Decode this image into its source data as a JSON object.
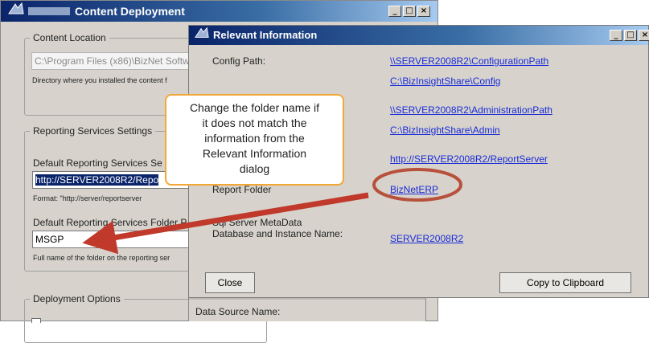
{
  "content_window": {
    "title": "Content Deployment",
    "location_group": {
      "legend": "Content Location",
      "path_value": "C:\\Program Files (x86)\\BizNet Softw",
      "hint": "Directory where you installed the content f"
    },
    "reporting_group": {
      "legend": "Reporting Services Settings",
      "server_label": "Default Reporting Services Se",
      "server_value": "http://SERVER2008R2/Repo",
      "server_hint": "Format: \"http://server/reportserver",
      "folder_label": "Default Reporting Services Folder P",
      "folder_value": "MSGP",
      "folder_hint": "Full name of the folder on the reporting ser"
    },
    "deployment_group": {
      "legend": "Deployment Options",
      "data_source_label": "Data Source Name:"
    }
  },
  "info_window": {
    "title": "Relevant Information",
    "rows": [
      {
        "label": "Config Path:",
        "link": "\\\\SERVER2008R2\\ConfigurationPath"
      },
      {
        "label": "",
        "link": "C:\\BizInsightShare\\Config"
      },
      {
        "label": "",
        "link": "\\\\SERVER2008R2\\AdministrationPath"
      },
      {
        "label": "",
        "link": "C:\\BizInsightShare\\Admin"
      },
      {
        "label": "",
        "link": "http://SERVER2008R2/ReportServer"
      },
      {
        "label": "Report Folder",
        "link": "BizNetERP"
      },
      {
        "label": "Sql Server MetaData\nDatabase and Instance Name:",
        "link": "SERVER2008R2"
      }
    ],
    "close_label": "Close",
    "copy_label": "Copy to Clipboard"
  },
  "callout": {
    "lines": [
      "Change the folder name if",
      "it does not match the",
      "information from the",
      "Relevant Information",
      "dialog"
    ]
  },
  "window_buttons": [
    "_",
    "□",
    "×"
  ],
  "colors": {
    "titlebar_dark": "#0a246a",
    "titlebar_light": "#a6caf0",
    "link": "#1a2bd6",
    "callout_border": "#f2a737",
    "annotation": "#c0392b"
  }
}
